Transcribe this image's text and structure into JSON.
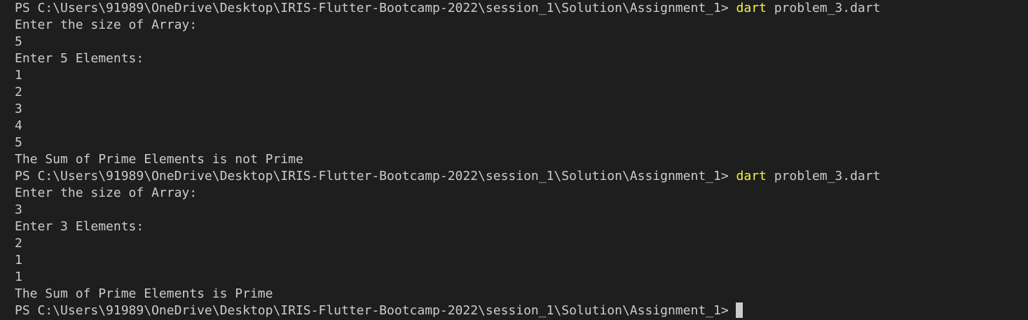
{
  "terminal": {
    "lines": [
      {
        "kind": "prompt",
        "prompt": "PS C:\\Users\\91989\\OneDrive\\Desktop\\IRIS-Flutter-Bootcamp-2022\\session_1\\Solution\\Assignment_1>",
        "command": "dart",
        "args": "problem_3.dart"
      },
      {
        "kind": "output",
        "text": "Enter the size of Array:"
      },
      {
        "kind": "output",
        "text": "5"
      },
      {
        "kind": "output",
        "text": "Enter 5 Elements:"
      },
      {
        "kind": "output",
        "text": "1"
      },
      {
        "kind": "output",
        "text": "2"
      },
      {
        "kind": "output",
        "text": "3"
      },
      {
        "kind": "output",
        "text": "4"
      },
      {
        "kind": "output",
        "text": "5"
      },
      {
        "kind": "output",
        "text": "The Sum of Prime Elements is not Prime"
      },
      {
        "kind": "prompt",
        "prompt": "PS C:\\Users\\91989\\OneDrive\\Desktop\\IRIS-Flutter-Bootcamp-2022\\session_1\\Solution\\Assignment_1>",
        "command": "dart",
        "args": "problem_3.dart"
      },
      {
        "kind": "output",
        "text": "Enter the size of Array:"
      },
      {
        "kind": "output",
        "text": "3"
      },
      {
        "kind": "output",
        "text": "Enter 3 Elements:"
      },
      {
        "kind": "output",
        "text": "2"
      },
      {
        "kind": "output",
        "text": "1"
      },
      {
        "kind": "output",
        "text": "1"
      },
      {
        "kind": "output",
        "text": "The Sum of Prime Elements is Prime"
      },
      {
        "kind": "active-prompt",
        "prompt": "PS C:\\Users\\91989\\OneDrive\\Desktop\\IRIS-Flutter-Bootcamp-2022\\session_1\\Solution\\Assignment_1>"
      }
    ]
  },
  "colors": {
    "background": "#1e1e1e",
    "text": "#cccccc",
    "command_highlight": "#f5f543"
  }
}
